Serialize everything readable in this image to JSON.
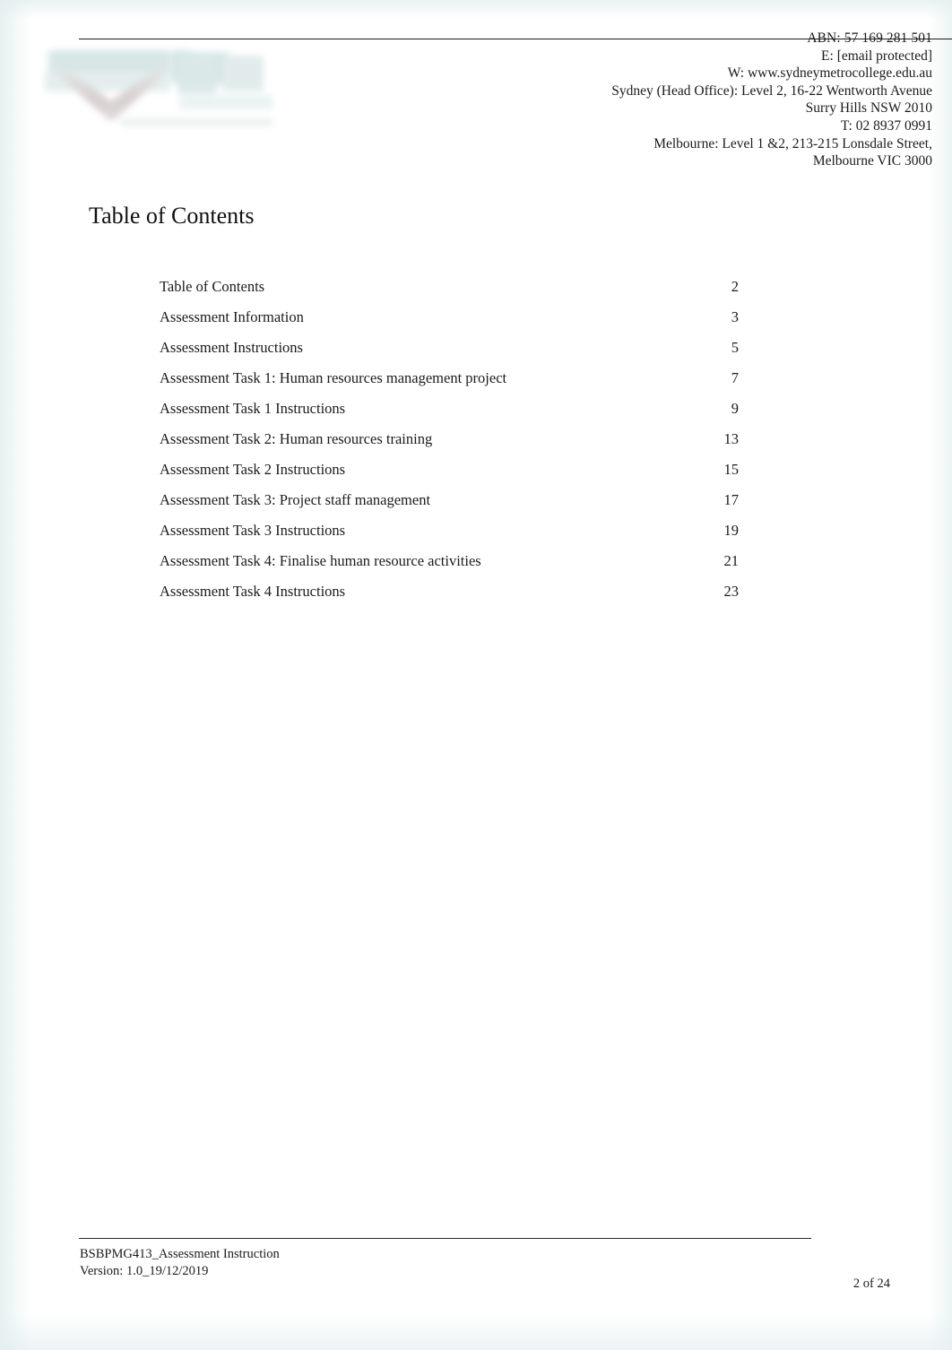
{
  "document": {
    "title": "Table of Contents",
    "page_background": "#ffffff",
    "text_color": "#1b1b1b"
  },
  "header": {
    "logo_alt": "Sydney Metro College logo",
    "contact": {
      "abn": "ABN: 57 169 281 501",
      "email": "E: [email protected]",
      "website": "W: www.sydneymetrocollege.edu.au",
      "sydney_address_line1": "Sydney (Head Office): Level 2, 16-22 Wentworth Avenue",
      "sydney_address_line2": "Surry Hills NSW 2010",
      "phone": "T: 02 8937 0991",
      "melbourne_address_line1": "Melbourne: Level 1 &2, 213-215 Lonsdale Street,",
      "melbourne_address_line2": "Melbourne VIC 3000"
    }
  },
  "toc": {
    "heading": "Table of Contents",
    "entries": [
      {
        "label": "Table of Contents",
        "page": "2"
      },
      {
        "label": "Assessment Information",
        "page": "3"
      },
      {
        "label": "Assessment Instructions",
        "page": "5"
      },
      {
        "label": "Assessment Task 1: Human resources management project",
        "page": "7"
      },
      {
        "label": "Assessment Task 1 Instructions",
        "page": "9"
      },
      {
        "label": "Assessment Task 2: Human resources training",
        "page": "13"
      },
      {
        "label": "Assessment Task 2 Instructions",
        "page": "15"
      },
      {
        "label": "Assessment Task 3: Project staff management",
        "page": "17"
      },
      {
        "label": "Assessment Task 3 Instructions",
        "page": "19"
      },
      {
        "label": "Assessment Task 4: Finalise human resource activities",
        "page": "21"
      },
      {
        "label": "Assessment Task 4 Instructions",
        "page": "23"
      }
    ]
  },
  "footer": {
    "document_code": "BSBPMG413_Assessment Instruction",
    "version": "Version: 1.0_19/12/2019",
    "page_indicator": "2 of 24"
  }
}
